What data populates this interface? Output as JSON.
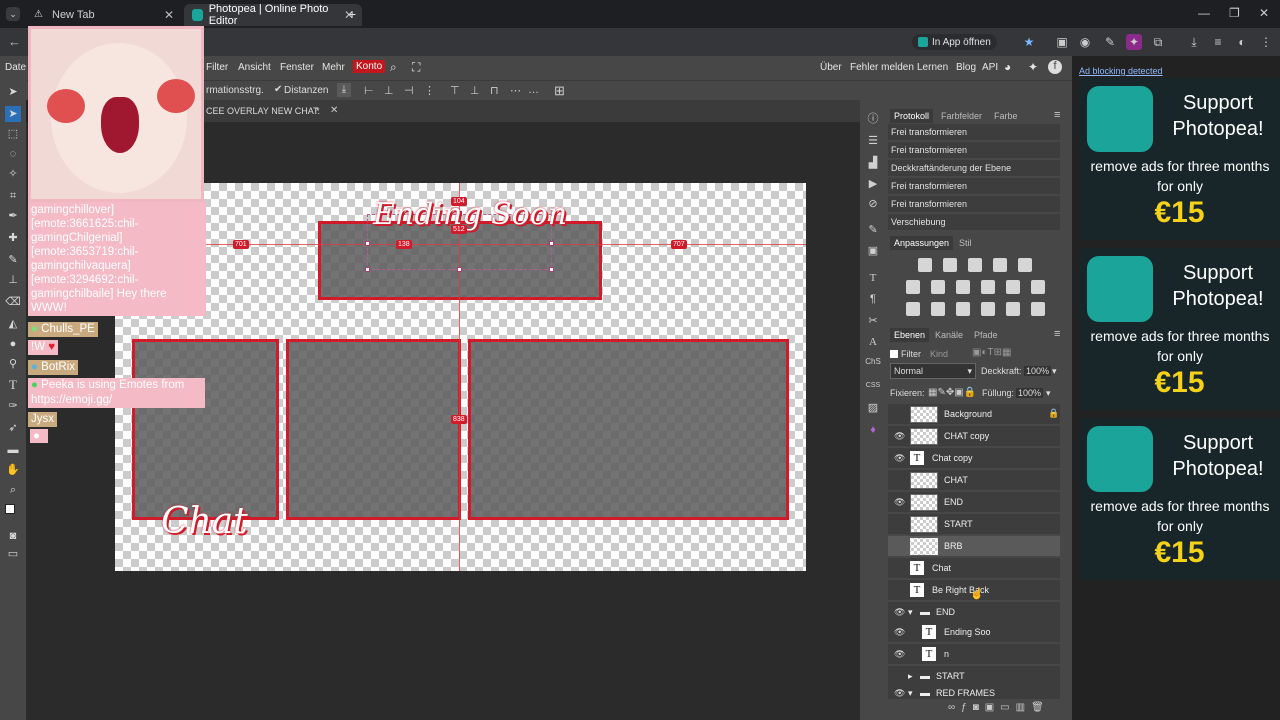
{
  "browser": {
    "tabs": [
      {
        "title": "New Tab"
      },
      {
        "title": "Photopea | Online Photo Editor"
      }
    ],
    "open_in_app": "In App öffnen"
  },
  "app": {
    "menu_left_cut": "Date",
    "menu": [
      "Filter",
      "Ansicht",
      "Fenster",
      "Mehr",
      "Konto"
    ],
    "menu_right": [
      "Über",
      "Fehler melden",
      "Lernen",
      "Blog",
      "API"
    ],
    "options": {
      "transform_cut": "rmationsstrg.",
      "distances": "Distanzen"
    },
    "document_tab": "CEE OVERLAY NEW CHAT.",
    "document_tab_suffix": "*"
  },
  "canvas": {
    "markers": [
      "104",
      "512",
      "138",
      "701",
      "707",
      "838"
    ],
    "overlay_text": {
      "ending": "Ending Soon",
      "chat": "Chat"
    }
  },
  "panels": {
    "top_tabs": [
      "Protokoll",
      "Farbfelder",
      "Farbe"
    ],
    "history": [
      "Frei transformieren",
      "Frei transformieren",
      "Deckkraftänderung der Ebene",
      "Frei transformieren",
      "Frei transformieren",
      "Verschiebung"
    ],
    "adj_tabs": [
      "Anpassungen",
      "Stil"
    ],
    "layer_tabs": [
      "Ebenen",
      "Kanäle",
      "Pfade"
    ],
    "filter_label": "Filter",
    "filter_kind": "Kind",
    "blend_mode": "Normal",
    "opacity_label": "Deckkraft:",
    "opacity_value": "100%",
    "lock_label": "Fixieren:",
    "fill_label": "Füllung:",
    "fill_value": "100%",
    "layers": [
      {
        "name": "Background",
        "type": "image",
        "visible": false
      },
      {
        "name": "CHAT copy",
        "type": "image",
        "visible": true
      },
      {
        "name": "Chat copy",
        "type": "text",
        "visible": true
      },
      {
        "name": "CHAT",
        "type": "image",
        "visible": false
      },
      {
        "name": "END",
        "type": "image",
        "visible": true
      },
      {
        "name": "START",
        "type": "image",
        "visible": false
      },
      {
        "name": "BRB",
        "type": "image",
        "visible": false,
        "selected": true
      },
      {
        "name": "Chat",
        "type": "text",
        "visible": false
      },
      {
        "name": "Be Right Back",
        "type": "text",
        "visible": false
      },
      {
        "name": "END",
        "type": "group",
        "visible": true
      },
      {
        "name": "Ending Soo",
        "type": "text",
        "visible": true
      },
      {
        "name": "n",
        "type": "text",
        "visible": true
      },
      {
        "name": "START",
        "type": "group",
        "visible": false
      },
      {
        "name": "RED FRAMES",
        "type": "group",
        "visible": true
      }
    ]
  },
  "ads": {
    "detected": "Ad blocking detected",
    "title": "Support Photopea!",
    "body": "remove ads for three months for only",
    "price": "€15"
  },
  "stream_chat": {
    "lines": [
      "gamingchillover]",
      "[emote:3661625:chil-",
      "gamingChilgenial]",
      "[emote:3653719:chil-",
      "gamingchilvaquera]",
      "[emote:3294692:chil-",
      "gamingchilbaile] Hey there",
      "WWW!"
    ],
    "user1": "Chulls_PE",
    "msg1": "!W",
    "user2": "BotRix",
    "msg2": "Peeka is using Emotes from https://emoji.gg/",
    "user3": "Jysx"
  }
}
